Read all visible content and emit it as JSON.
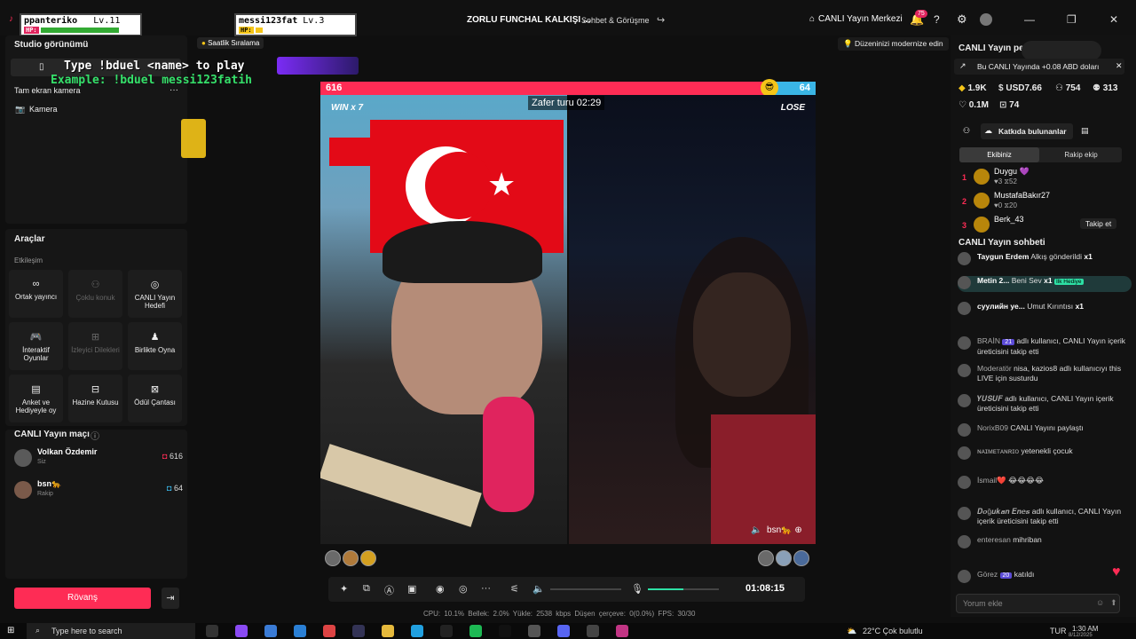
{
  "topbar": {
    "app_icon": "tiktok-icon",
    "title": "ZORLU FUNCHAL KALKIŞI ...",
    "category": "Sohbet & Görüşme",
    "live_center": "CANLI Yayın Merkezi",
    "notification_count": "75",
    "min": "—",
    "max": "❐",
    "close": "✕"
  },
  "overlay": {
    "player1_name": "ppanteriko",
    "player1_level": "Lv.11",
    "player2_name": "messi123fat",
    "player2_level": "Lv.3",
    "hp_label": "HP:",
    "hint": "Type !bduel <name> to play",
    "example": "Example: !bduel messi123fatih",
    "hourly_ranking": "Saatlik Sıralama",
    "modernize": "Düzeninizi modernize edin"
  },
  "left": {
    "studio_view": "Studio görünümü",
    "fullscreen_camera": "Tam ekran kamera",
    "camera": "Kamera",
    "tools": "Araçlar",
    "interaction": "Etkileşim",
    "tiles": [
      {
        "label": "Ortak yayıncı",
        "icon": "link-icon",
        "dim": false
      },
      {
        "label": "Çoklu konuk",
        "icon": "users-icon",
        "dim": true
      },
      {
        "label": "CANLI Yayın Hedefi",
        "icon": "target-icon",
        "dim": false
      },
      {
        "label": "İnteraktif Oyunlar",
        "icon": "gamepad-icon",
        "dim": false
      },
      {
        "label": "İzleyici Dilekleri",
        "icon": "grid-icon",
        "dim": true
      },
      {
        "label": "Birlikte Oyna",
        "icon": "joystick-icon",
        "dim": false
      },
      {
        "label": "Anket ve Hediyeyle oy",
        "icon": "poll-icon",
        "dim": false
      },
      {
        "label": "Hazine Kutusu",
        "icon": "chest-icon",
        "dim": false
      },
      {
        "label": "Ödül Çantası",
        "icon": "bag-icon",
        "dim": false
      }
    ],
    "match_title": "CANLI Yayın maçı",
    "match_rows": [
      {
        "name": "Volkan Özdemir",
        "sub": "Siz",
        "score": "616"
      },
      {
        "name": "bsn🐆",
        "sub": "Rakip",
        "score": "64"
      }
    ],
    "rematch": "Rövanş"
  },
  "battle": {
    "score_left": 616,
    "score_right": 64,
    "win_streak": "WIN x 7",
    "result_right": "LOSE",
    "round_timer": "Zafer turu 02:29",
    "opponent_tag": "bsn🐆"
  },
  "controls": {
    "time": "01:08:15",
    "volume_level": 0.5,
    "stats": "CPU: 10.1%   Bellek: 2.0%   Yükle: 2538 kbps   Düşen çerçeve: 0(0.0%)   FPS: 30/30"
  },
  "right": {
    "header": "CANLI Yayın pe...",
    "earn_note": "Bu CANLI Yayında +0.08 ABD doları",
    "stats": [
      {
        "icon": "diamond-icon",
        "value": "1.9K"
      },
      {
        "icon": "dollar-icon",
        "value": "USD7.66"
      },
      {
        "icon": "people-icon",
        "value": "754"
      },
      {
        "icon": "users-icon",
        "value": "313"
      },
      {
        "icon": "heart-icon",
        "value": "0.1M"
      },
      {
        "icon": "gift-icon",
        "value": "74"
      }
    ],
    "contributors": "Katkıda bulunanlar",
    "tab_ours": "Ekibiniz",
    "tab_rival": "Rakip ekip",
    "ranking": [
      {
        "n": "1",
        "name": "Duygu 💜",
        "stats": "♥3 ⧖52"
      },
      {
        "n": "2",
        "name": "MustafaBakır27",
        "stats": "♥0 ⧖20"
      },
      {
        "n": "3",
        "name": "Berk_43",
        "stats": ""
      }
    ],
    "follow": "Takip et",
    "chat_title": "CANLI Yayın sohbeti",
    "chat": [
      {
        "user": "Taygun Erdem",
        "text": "Alkış gönderildi",
        "extra": "x1"
      },
      {
        "user": "Metin 2...",
        "text": "Beni Sev",
        "extra": "x1",
        "tag": "İlk Hediye"
      },
      {
        "user": "суулийн уе...",
        "text": "Umut Kırıntısı",
        "extra": "x1"
      },
      {
        "user": "BRAİN",
        "badge": "21",
        "text": "adlı kullanıcı, CANLI Yayın içerik üreticisini takip etti"
      },
      {
        "user": "Moderatör",
        "text": "nisa, kazios8 adlı kullanıcıyı this LIVE için susturdu"
      },
      {
        "user": "𝒀𝑼𝑺𝑼𝑭",
        "text": "adlı kullanıcı, CANLI Yayın içerik üreticisini takip etti"
      },
      {
        "user": "NorixB09",
        "text": "CANLI Yayını paylaştı"
      },
      {
        "user": "ɴᴀɪᴍᴇᴛᴀɴʀɪᴏ",
        "text": "yetenekli çocuk"
      },
      {
        "user": "İsmail❤️",
        "text": "😂😂😂😂"
      },
      {
        "user": "𝑫𝒐ğ𝒖𝒌𝒂𝒏 𝑬𝒏𝒆𝒔",
        "text": "adlı kullanıcı, CANLI Yayın içerik üreticisini takip etti"
      },
      {
        "user": "enteresan",
        "text": "mihriban"
      },
      {
        "user": "Görez",
        "badge": "20",
        "text": "katıldı"
      }
    ],
    "chat_placeholder": "Yorum ekle"
  },
  "taskbar": {
    "search_placeholder": "Type here to search",
    "weather": "22°C  Çok bulutlu",
    "lang": "TUR",
    "time": "1:30 AM",
    "date": "8/12/2025"
  }
}
